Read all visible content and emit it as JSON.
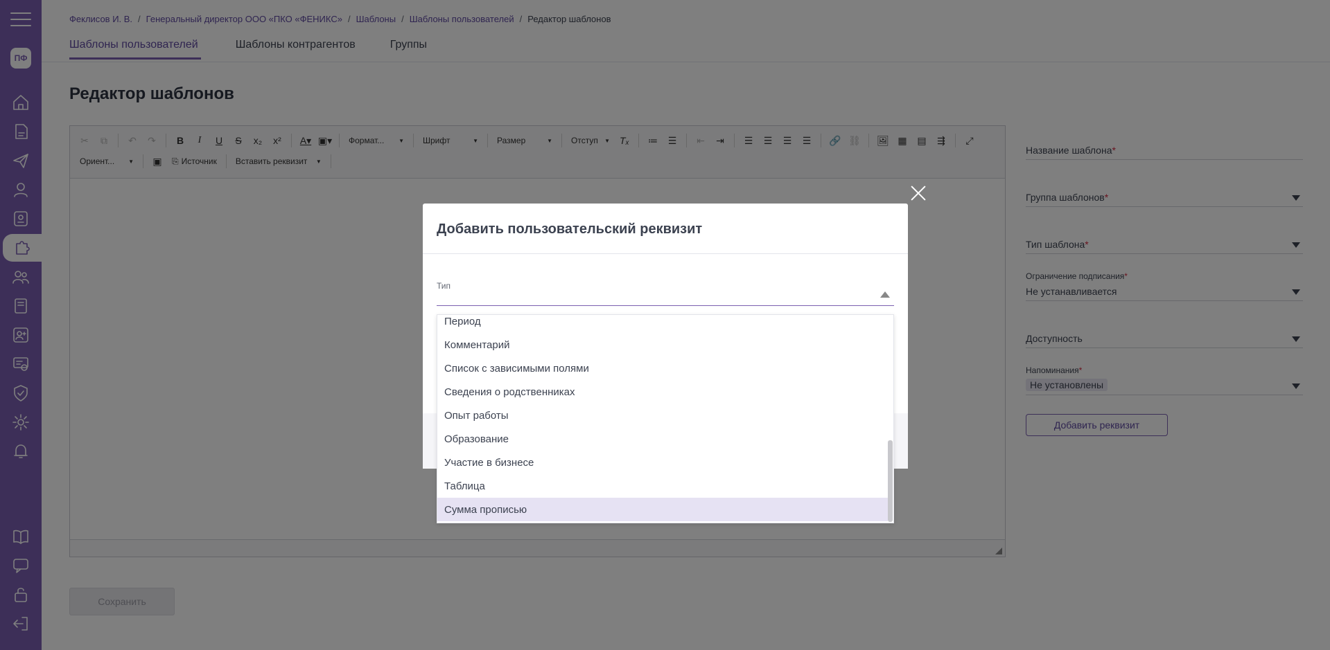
{
  "sidebar": {
    "avatar_initials": "ПФ",
    "icons": [
      "home-icon",
      "document-icon",
      "send-icon",
      "user-icon",
      "badge-icon",
      "puzzle-icon",
      "users-icon",
      "book-icon",
      "person-add-icon",
      "certificate-icon",
      "shield-icon",
      "gear-icon",
      "bell-icon",
      "manual-icon",
      "chat-icon",
      "lock-open-icon",
      "logout-icon"
    ]
  },
  "breadcrumb": {
    "items": [
      "Феклисов И. В.",
      "Генеральный директор ООО «ПКО «ФЕНИКС»",
      "Шаблоны",
      "Шаблоны пользователей"
    ],
    "current": "Редактор шаблонов",
    "separator": "/"
  },
  "tabs": [
    {
      "label": "Шаблоны пользователей",
      "active": true
    },
    {
      "label": "Шаблоны контрагентов",
      "active": false
    },
    {
      "label": "Группы",
      "active": false
    }
  ],
  "page_title": "Редактор шаблонов",
  "toolbar": {
    "format": "Формат...",
    "font": "Шрифт",
    "size": "Размер",
    "indent": "Отступ",
    "orientation": "Ориент...",
    "source": "Источник",
    "insert_requisite": "Вставить реквизит"
  },
  "save_label": "Сохранить",
  "right_panel": {
    "template_name_label": "Название шаблона",
    "template_group_label": "Группа шаблонов",
    "template_type_label": "Тип шаблона",
    "sign_restriction_label": "Ограничение подписания",
    "sign_restriction_value": "Не устанавливается",
    "availability_label": "Доступность",
    "reminders_label": "Напоминания",
    "reminders_value": "Не установлены",
    "required_mark": "*",
    "add_requisite_button": "Добавить реквизит"
  },
  "modal": {
    "title": "Добавить пользовательский реквизит",
    "type_label": "Тип",
    "options": [
      "Период",
      "Комментарий",
      "Список с зависимыми полями",
      "Сведения о родственниках",
      "Опыт работы",
      "Образование",
      "Участие в бизнесе",
      "Таблица",
      "Сумма прописью"
    ],
    "highlighted": "Сумма прописью"
  },
  "colors": {
    "sidebar": "#7a5fb0",
    "accent": "#5f49a0",
    "required": "#d0273e",
    "highlight": "#e6e2f3"
  }
}
